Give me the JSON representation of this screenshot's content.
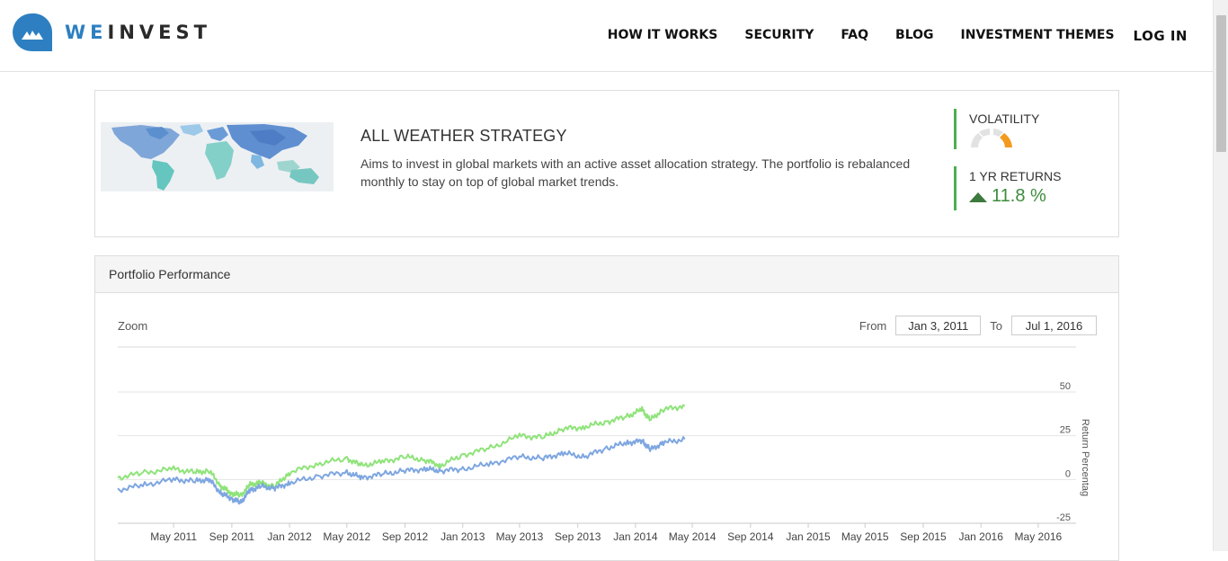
{
  "brand": {
    "name_a": "WE",
    "name_b": "INVEST",
    "accent": "#2d7fc1"
  },
  "nav": {
    "items": [
      "HOW IT WORKS",
      "SECURITY",
      "FAQ",
      "BLOG",
      "INVESTMENT THEMES"
    ],
    "login": "LOG IN"
  },
  "strategy": {
    "title": "ALL WEATHER STRATEGY",
    "description": "Aims to invest in global markets with an active asset allocation strategy. The portfolio is rebalanced monthly to stay on top of global market trends.",
    "volatility_label": "VOLATILITY",
    "volatility_icon": "gauge-icon",
    "returns_label": "1 YR RETURNS",
    "returns_value": "11.8 %",
    "returns_icon": "triangle-up-icon",
    "positive_color": "#3d8b3d",
    "metric_bar_color": "#4caf50",
    "gauge_color": "#f39a1e"
  },
  "performance": {
    "heading": "Portfolio Performance",
    "zoom_label": "Zoom",
    "from_label": "From",
    "from_value": "Jan 3, 2011",
    "to_label": "To",
    "to_value": "Jul 1, 2016"
  },
  "chart_data": {
    "type": "line",
    "title": "",
    "xlabel": "",
    "ylabel": "Return Percentag",
    "xlim": [
      "2011-01-03",
      "2016-07-01"
    ],
    "ylim": [
      -25,
      50
    ],
    "yticks": [
      50,
      25,
      0,
      -25
    ],
    "xticks": [
      "May 2011",
      "Sep 2011",
      "Jan 2012",
      "May 2012",
      "Sep 2012",
      "Jan 2013",
      "May 2013",
      "Sep 2013",
      "Jan 2014",
      "May 2014",
      "Sep 2014",
      "Jan 2015",
      "May 2015",
      "Sep 2015",
      "Jan 2016",
      "May 2016"
    ],
    "grid": true,
    "series": [
      {
        "color": "#8fe37a",
        "x": [
          "2011-01-03",
          "2011-03-01",
          "2011-05-01",
          "2011-06-15",
          "2011-07-15",
          "2011-08-10",
          "2011-09-01",
          "2011-09-20",
          "2011-10-10",
          "2011-11-01",
          "2011-12-01",
          "2012-01-01",
          "2012-03-01",
          "2012-05-01",
          "2012-06-01",
          "2012-07-15",
          "2012-09-01",
          "2012-10-15",
          "2012-11-15",
          "2013-01-01",
          "2013-03-01",
          "2013-05-01",
          "2013-06-20",
          "2013-08-01",
          "2013-09-15",
          "2013-11-01",
          "2013-12-15",
          "2014-01-15",
          "2014-02-01",
          "2014-03-01",
          "2014-04-15"
        ],
        "y": [
          1,
          4,
          6,
          4,
          5,
          -4,
          -8,
          -9,
          -3,
          -2,
          -4,
          4,
          9,
          12,
          8,
          10,
          13,
          11,
          8,
          14,
          18,
          25,
          24,
          29,
          30,
          33,
          36,
          40,
          34,
          40,
          42
        ]
      },
      {
        "color": "#7ea6e0",
        "x": [
          "2011-01-03",
          "2011-03-01",
          "2011-05-01",
          "2011-06-15",
          "2011-07-15",
          "2011-08-10",
          "2011-09-01",
          "2011-09-20",
          "2011-10-10",
          "2011-11-01",
          "2011-12-01",
          "2012-01-01",
          "2012-03-01",
          "2012-05-01",
          "2012-06-01",
          "2012-07-15",
          "2012-09-01",
          "2012-10-15",
          "2012-11-15",
          "2013-01-01",
          "2013-03-01",
          "2013-05-01",
          "2013-06-20",
          "2013-08-01",
          "2013-09-15",
          "2013-11-01",
          "2013-12-15",
          "2014-01-15",
          "2014-02-01",
          "2014-03-01",
          "2014-04-15"
        ],
        "y": [
          -6,
          -3,
          0,
          -1,
          0,
          -8,
          -11,
          -13,
          -6,
          -4,
          -5,
          -2,
          2,
          4,
          1,
          3,
          5,
          6,
          5,
          6,
          9,
          13,
          12,
          15,
          13,
          18,
          21,
          22,
          17,
          21,
          23
        ]
      }
    ]
  }
}
